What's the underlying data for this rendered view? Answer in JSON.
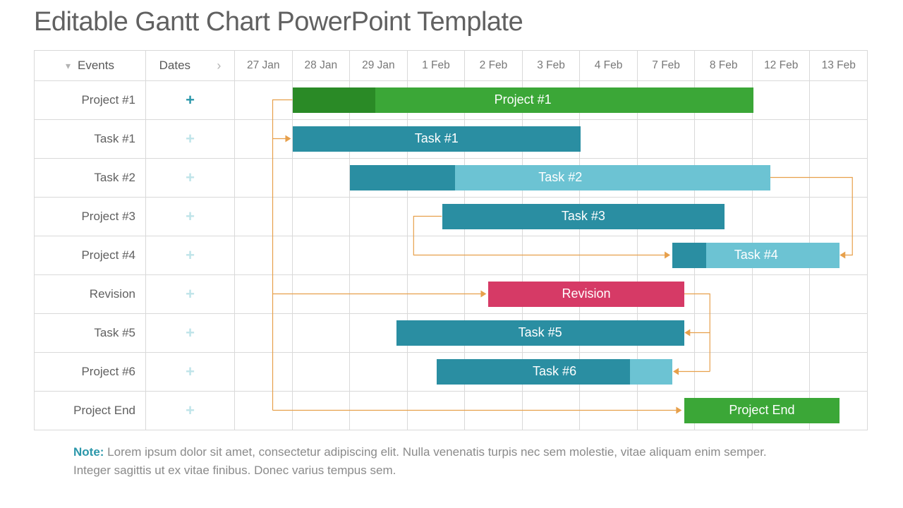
{
  "title": "Editable Gantt Chart PowerPoint Template",
  "header": {
    "events": "Events",
    "dates_col": "Dates"
  },
  "dates": [
    "27 Jan",
    "28 Jan",
    "29 Jan",
    "1 Feb",
    "2 Feb",
    "3 Feb",
    "4 Feb",
    "7 Feb",
    "8 Feb",
    "12 Feb",
    "13 Feb"
  ],
  "rows": [
    {
      "label": "Project #1",
      "expanded": true
    },
    {
      "label": "Task #1",
      "expanded": false
    },
    {
      "label": "Task #2",
      "expanded": false
    },
    {
      "label": "Project #3",
      "expanded": false
    },
    {
      "label": "Project #4",
      "expanded": false
    },
    {
      "label": "Revision",
      "expanded": false
    },
    {
      "label": "Task #5",
      "expanded": false
    },
    {
      "label": "Project #6",
      "expanded": false
    },
    {
      "label": "Project End",
      "expanded": false
    }
  ],
  "note_prefix": "Note:",
  "note_body": " Lorem ipsum dolor sit amet, consectetur adipiscing elit. Nulla venenatis turpis nec sem molestie, vitae aliquam enim semper. Integer sagittis ut ex vitae finibus. Donec varius tempus sem.",
  "colors": {
    "green": "#3ba737",
    "green_dk": "#2a8a26",
    "teal": "#2a8ea2",
    "teal_lt": "#6cc3d3",
    "pink": "#d63a66",
    "orange": "#e7a04b"
  },
  "chart_data": {
    "type": "gantt",
    "timescale": [
      "27 Jan",
      "28 Jan",
      "29 Jan",
      "1 Feb",
      "2 Feb",
      "3 Feb",
      "4 Feb",
      "7 Feb",
      "8 Feb",
      "12 Feb",
      "13 Feb"
    ],
    "rows": [
      "Project #1",
      "Task #1",
      "Task #2",
      "Project #3",
      "Project #4",
      "Revision",
      "Task #5",
      "Project #6",
      "Project End"
    ],
    "bars": [
      {
        "row": 0,
        "label": "Project #1",
        "start": 1,
        "end": 9,
        "color": "green",
        "progress_pct": 18
      },
      {
        "row": 1,
        "label": "Task #1",
        "start": 1,
        "end": 6,
        "color": "teal"
      },
      {
        "row": 2,
        "label": "Task #2",
        "start": 2,
        "end": 9.3,
        "color": "teal",
        "progress_pct": 25,
        "progress_color": "teal",
        "rest_color": "teal_lt"
      },
      {
        "row": 3,
        "label": "Task #3",
        "start": 3.6,
        "end": 8.5,
        "color": "teal"
      },
      {
        "row": 4,
        "label": "Task #4",
        "start": 7.6,
        "end": 10.5,
        "color": "teal_lt",
        "progress_pct": 20,
        "progress_color": "teal"
      },
      {
        "row": 5,
        "label": "Revision",
        "start": 4.4,
        "end": 7.8,
        "color": "pink"
      },
      {
        "row": 6,
        "label": "Task #5",
        "start": 2.8,
        "end": 7.8,
        "color": "teal"
      },
      {
        "row": 7,
        "label": "Task #6",
        "start": 3.5,
        "end": 7.6,
        "color": "teal",
        "progress_pct": 82,
        "progress_color": "teal",
        "rest_color": "teal_lt"
      },
      {
        "row": 8,
        "label": "Project End",
        "start": 7.8,
        "end": 10.5,
        "color": "green"
      }
    ],
    "dependencies": [
      {
        "from_row": 0,
        "to_row": 1,
        "type": "start-start"
      },
      {
        "from_row": 0,
        "to_row": 5,
        "type": "start-start"
      },
      {
        "from_row": 0,
        "to_row": 8,
        "type": "start-start"
      },
      {
        "from_row": 2,
        "to_row": 4,
        "type": "finish-finish"
      },
      {
        "from_row": 3,
        "to_row": 4,
        "type": "start-start"
      },
      {
        "from_row": 5,
        "to_row": 6,
        "type": "finish-finish"
      },
      {
        "from_row": 5,
        "to_row": 7,
        "type": "finish-finish"
      }
    ]
  }
}
